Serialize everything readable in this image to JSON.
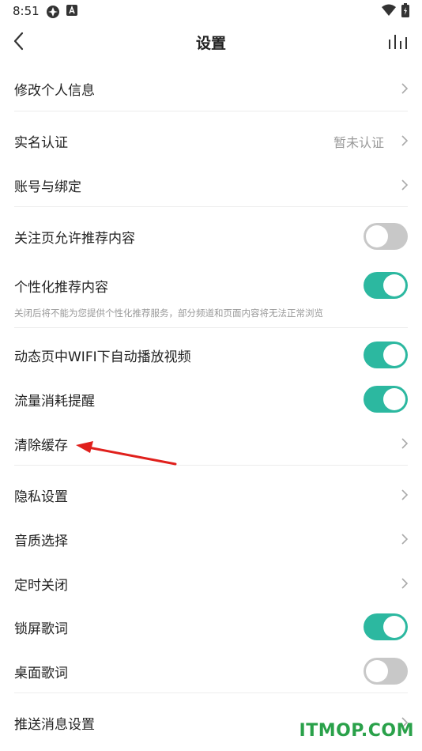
{
  "status_bar": {
    "time": "8:51"
  },
  "header": {
    "title": "设置"
  },
  "rows": {
    "edit_profile": {
      "label": "修改个人信息"
    },
    "real_name": {
      "label": "实名认证",
      "value": "暂未认证"
    },
    "account_binding": {
      "label": "账号与绑定"
    },
    "follow_recommend": {
      "label": "关注页允许推荐内容",
      "enabled": false
    },
    "personalized": {
      "label": "个性化推荐内容",
      "enabled": true,
      "hint": "关闭后将不能为您提供个性化推荐服务，部分频道和页面内容将无法正常浏览"
    },
    "wifi_autoplay": {
      "label": "动态页中WIFI下自动播放视频",
      "enabled": true
    },
    "data_reminder": {
      "label": "流量消耗提醒",
      "enabled": true
    },
    "clear_cache": {
      "label": "清除缓存"
    },
    "privacy": {
      "label": "隐私设置"
    },
    "audio_quality": {
      "label": "音质选择"
    },
    "timer_close": {
      "label": "定时关闭"
    },
    "lock_lyrics": {
      "label": "锁屏歌词",
      "enabled": true
    },
    "desktop_lyrics": {
      "label": "桌面歌词",
      "enabled": false
    },
    "push_settings": {
      "label": "推送消息设置"
    }
  },
  "colors": {
    "toggle_on": "#2cb8a0",
    "toggle_off": "#c8c8c8",
    "annotation_arrow": "#e0201c",
    "watermark": "#2aa14a"
  },
  "watermark": {
    "text": "ITMOP.COM"
  }
}
